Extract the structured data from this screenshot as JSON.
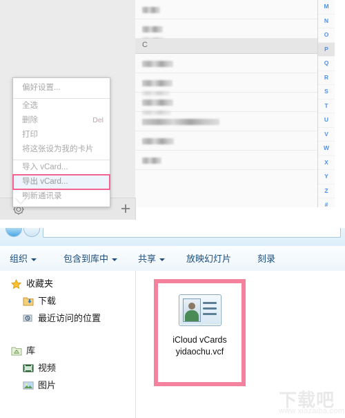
{
  "contacts_app": {
    "context_menu": {
      "items": [
        {
          "label": "偏好设置...",
          "shortcut": "",
          "highlighted": false,
          "separator_after": true
        },
        {
          "label": "全选",
          "shortcut": "",
          "highlighted": false,
          "separator_after": false
        },
        {
          "label": "删除",
          "shortcut": "Del",
          "highlighted": false,
          "separator_after": false
        },
        {
          "label": "打印",
          "shortcut": "",
          "highlighted": false,
          "separator_after": false
        },
        {
          "label": "将这张设为我的卡片",
          "shortcut": "",
          "highlighted": false,
          "separator_after": true
        },
        {
          "label": "导入 vCard...",
          "shortcut": "",
          "highlighted": false,
          "separator_after": false
        },
        {
          "label": "导出 vCard...",
          "shortcut": "",
          "highlighted": true,
          "separator_after": false
        },
        {
          "label": "刷新通讯录",
          "shortcut": "",
          "highlighted": false,
          "separator_after": false
        }
      ],
      "highlight_color": "#f4628f"
    },
    "toolbar": {
      "settings_icon": "gear-icon",
      "add_label": "+"
    },
    "list": {
      "rows": [
        {
          "type": "contact",
          "name_redacted": true,
          "name_width": 26,
          "has_subline": false,
          "sub_width": 0
        },
        {
          "type": "contact",
          "name_redacted": true,
          "name_width": 30,
          "has_subline": true,
          "sub_width": 32
        },
        {
          "type": "section",
          "label": "C"
        },
        {
          "type": "contact",
          "name_redacted": true,
          "name_width": 45,
          "has_subline": false,
          "sub_width": 0
        },
        {
          "type": "contact",
          "name_redacted": true,
          "name_width": 44,
          "has_subline": true,
          "sub_width": 40
        },
        {
          "type": "contact",
          "name_redacted": true,
          "name_width": 45,
          "has_subline": true,
          "sub_width": 42
        },
        {
          "type": "contact",
          "name_redacted": true,
          "name_width": 112,
          "has_subline": false,
          "sub_width": 0
        },
        {
          "type": "contact",
          "name_redacted": true,
          "name_width": 46,
          "has_subline": false,
          "sub_width": 0
        },
        {
          "type": "contact",
          "name_redacted": true,
          "name_width": 28,
          "has_subline": false,
          "sub_width": 0
        }
      ]
    },
    "index": {
      "letters": [
        "M",
        "N",
        "O",
        "P",
        "Q",
        "R",
        "S",
        "T",
        "U",
        "V",
        "W",
        "X",
        "Y",
        "Z",
        "#"
      ],
      "selected": "P",
      "color": "#4a90e8"
    }
  },
  "explorer": {
    "toolbar": {
      "items": [
        {
          "label": "组织",
          "has_caret": true
        },
        {
          "label": "包含到库中",
          "has_caret": true
        },
        {
          "label": "共享",
          "has_caret": true
        },
        {
          "label": "放映幻灯片",
          "has_caret": false
        },
        {
          "label": "刻录",
          "has_caret": false
        }
      ]
    },
    "navbar": {
      "back_icon": "back-arrow-icon",
      "forward_icon": "forward-arrow-icon"
    },
    "sidebar": {
      "groups": [
        {
          "header": {
            "label": "收藏夹",
            "icon": "star-icon"
          },
          "items": [
            {
              "label": "下载",
              "icon": "download-folder-icon"
            },
            {
              "label": "最近访问的位置",
              "icon": "recent-places-icon"
            }
          ]
        },
        {
          "header": {
            "label": "库",
            "icon": "library-folder-icon"
          },
          "items": [
            {
              "label": "视频",
              "icon": "video-icon"
            },
            {
              "label": "图片",
              "icon": "pictures-icon"
            }
          ]
        }
      ]
    },
    "file": {
      "name_line1": "iCloud vCards",
      "name_line2": "yidaochu.vcf",
      "icon": "vcard-contact-icon",
      "selection_color": "#f4829f"
    }
  },
  "watermark": {
    "main": "下载吧",
    "sub": "www.xiazaiba.com"
  }
}
